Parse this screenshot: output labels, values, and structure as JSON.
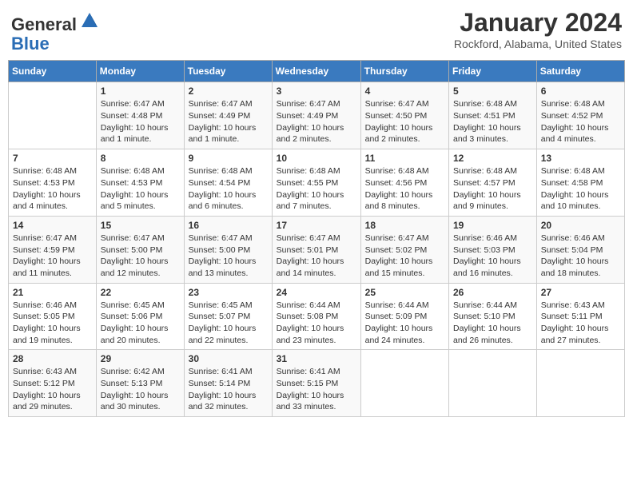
{
  "logo": {
    "general": "General",
    "blue": "Blue"
  },
  "header": {
    "month": "January 2024",
    "location": "Rockford, Alabama, United States"
  },
  "days_of_week": [
    "Sunday",
    "Monday",
    "Tuesday",
    "Wednesday",
    "Thursday",
    "Friday",
    "Saturday"
  ],
  "weeks": [
    [
      {
        "day": "",
        "info": ""
      },
      {
        "day": "1",
        "info": "Sunrise: 6:47 AM\nSunset: 4:48 PM\nDaylight: 10 hours and 1 minute."
      },
      {
        "day": "2",
        "info": "Sunrise: 6:47 AM\nSunset: 4:49 PM\nDaylight: 10 hours and 1 minute."
      },
      {
        "day": "3",
        "info": "Sunrise: 6:47 AM\nSunset: 4:49 PM\nDaylight: 10 hours and 2 minutes."
      },
      {
        "day": "4",
        "info": "Sunrise: 6:47 AM\nSunset: 4:50 PM\nDaylight: 10 hours and 2 minutes."
      },
      {
        "day": "5",
        "info": "Sunrise: 6:48 AM\nSunset: 4:51 PM\nDaylight: 10 hours and 3 minutes."
      },
      {
        "day": "6",
        "info": "Sunrise: 6:48 AM\nSunset: 4:52 PM\nDaylight: 10 hours and 4 minutes."
      }
    ],
    [
      {
        "day": "7",
        "info": "Sunrise: 6:48 AM\nSunset: 4:53 PM\nDaylight: 10 hours and 4 minutes."
      },
      {
        "day": "8",
        "info": "Sunrise: 6:48 AM\nSunset: 4:53 PM\nDaylight: 10 hours and 5 minutes."
      },
      {
        "day": "9",
        "info": "Sunrise: 6:48 AM\nSunset: 4:54 PM\nDaylight: 10 hours and 6 minutes."
      },
      {
        "day": "10",
        "info": "Sunrise: 6:48 AM\nSunset: 4:55 PM\nDaylight: 10 hours and 7 minutes."
      },
      {
        "day": "11",
        "info": "Sunrise: 6:48 AM\nSunset: 4:56 PM\nDaylight: 10 hours and 8 minutes."
      },
      {
        "day": "12",
        "info": "Sunrise: 6:48 AM\nSunset: 4:57 PM\nDaylight: 10 hours and 9 minutes."
      },
      {
        "day": "13",
        "info": "Sunrise: 6:48 AM\nSunset: 4:58 PM\nDaylight: 10 hours and 10 minutes."
      }
    ],
    [
      {
        "day": "14",
        "info": "Sunrise: 6:47 AM\nSunset: 4:59 PM\nDaylight: 10 hours and 11 minutes."
      },
      {
        "day": "15",
        "info": "Sunrise: 6:47 AM\nSunset: 5:00 PM\nDaylight: 10 hours and 12 minutes."
      },
      {
        "day": "16",
        "info": "Sunrise: 6:47 AM\nSunset: 5:00 PM\nDaylight: 10 hours and 13 minutes."
      },
      {
        "day": "17",
        "info": "Sunrise: 6:47 AM\nSunset: 5:01 PM\nDaylight: 10 hours and 14 minutes."
      },
      {
        "day": "18",
        "info": "Sunrise: 6:47 AM\nSunset: 5:02 PM\nDaylight: 10 hours and 15 minutes."
      },
      {
        "day": "19",
        "info": "Sunrise: 6:46 AM\nSunset: 5:03 PM\nDaylight: 10 hours and 16 minutes."
      },
      {
        "day": "20",
        "info": "Sunrise: 6:46 AM\nSunset: 5:04 PM\nDaylight: 10 hours and 18 minutes."
      }
    ],
    [
      {
        "day": "21",
        "info": "Sunrise: 6:46 AM\nSunset: 5:05 PM\nDaylight: 10 hours and 19 minutes."
      },
      {
        "day": "22",
        "info": "Sunrise: 6:45 AM\nSunset: 5:06 PM\nDaylight: 10 hours and 20 minutes."
      },
      {
        "day": "23",
        "info": "Sunrise: 6:45 AM\nSunset: 5:07 PM\nDaylight: 10 hours and 22 minutes."
      },
      {
        "day": "24",
        "info": "Sunrise: 6:44 AM\nSunset: 5:08 PM\nDaylight: 10 hours and 23 minutes."
      },
      {
        "day": "25",
        "info": "Sunrise: 6:44 AM\nSunset: 5:09 PM\nDaylight: 10 hours and 24 minutes."
      },
      {
        "day": "26",
        "info": "Sunrise: 6:44 AM\nSunset: 5:10 PM\nDaylight: 10 hours and 26 minutes."
      },
      {
        "day": "27",
        "info": "Sunrise: 6:43 AM\nSunset: 5:11 PM\nDaylight: 10 hours and 27 minutes."
      }
    ],
    [
      {
        "day": "28",
        "info": "Sunrise: 6:43 AM\nSunset: 5:12 PM\nDaylight: 10 hours and 29 minutes."
      },
      {
        "day": "29",
        "info": "Sunrise: 6:42 AM\nSunset: 5:13 PM\nDaylight: 10 hours and 30 minutes."
      },
      {
        "day": "30",
        "info": "Sunrise: 6:41 AM\nSunset: 5:14 PM\nDaylight: 10 hours and 32 minutes."
      },
      {
        "day": "31",
        "info": "Sunrise: 6:41 AM\nSunset: 5:15 PM\nDaylight: 10 hours and 33 minutes."
      },
      {
        "day": "",
        "info": ""
      },
      {
        "day": "",
        "info": ""
      },
      {
        "day": "",
        "info": ""
      }
    ]
  ]
}
